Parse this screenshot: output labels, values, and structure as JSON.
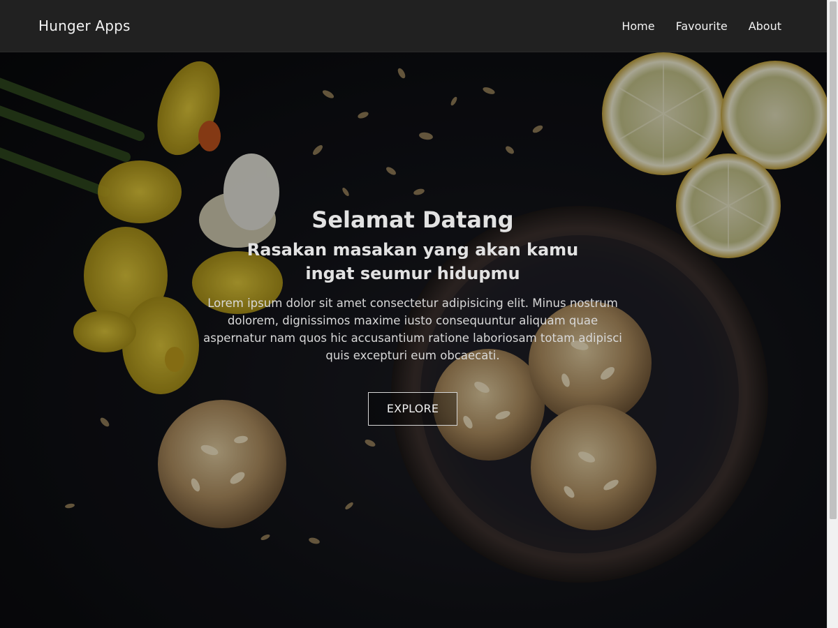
{
  "app": {
    "brand": "Hunger Apps",
    "nav": [
      {
        "label": "Home"
      },
      {
        "label": "Favourite"
      },
      {
        "label": "About"
      }
    ]
  },
  "hero": {
    "title": "Selamat Datang",
    "subtitle": "Rasakan masakan yang akan kamu ingat seumur hidupmu",
    "description": "Lorem ipsum dolor sit amet consectetur adipisicing elit. Minus nostrum dolorem, dignissimos maxime iusto consequuntur aliquam quae aspernatur nam quos hic accusantium ratione laboriosam totam adipisci quis excepturi eum obcaecati.",
    "cta_label": "EXPLORE"
  },
  "colors": {
    "appbar_bg": "#212121",
    "text": "#f2f2f2",
    "hero_bg": "#0c0c0f"
  }
}
